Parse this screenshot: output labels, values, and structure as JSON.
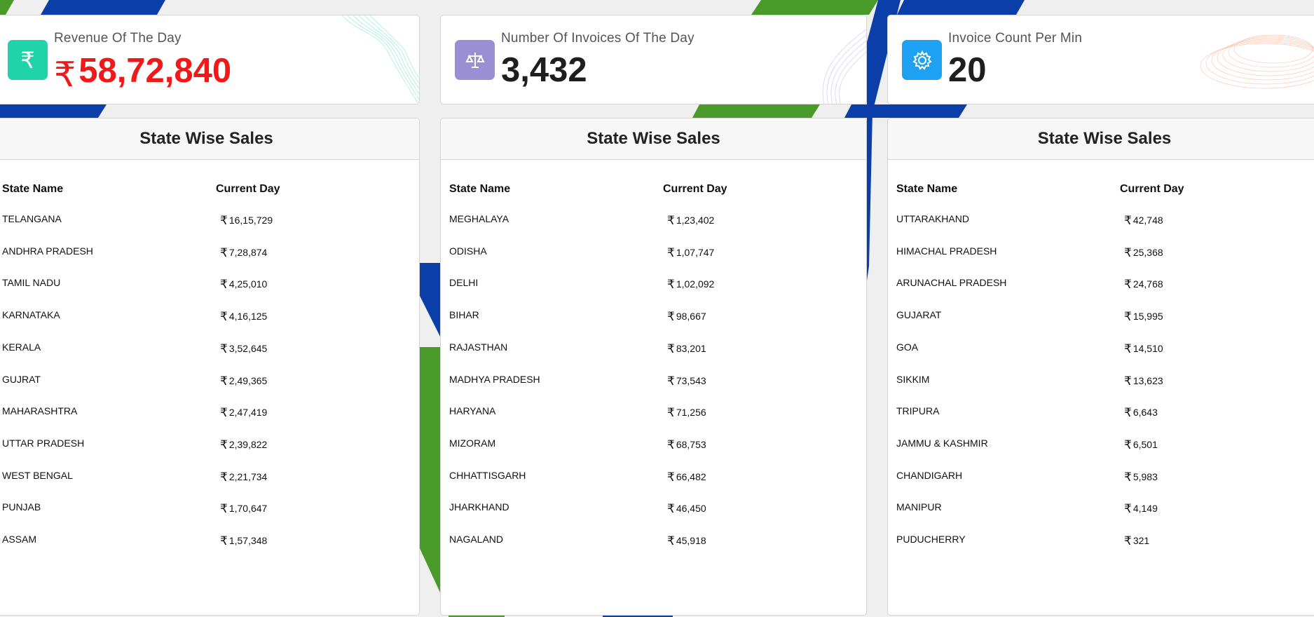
{
  "stats": [
    {
      "title": "Revenue Of The Day",
      "currency": "₹",
      "value": "58,72,840",
      "icon": "rupee-icon"
    },
    {
      "title": "Number Of Invoices Of The Day",
      "value": "3,432",
      "icon": "balance-scale-icon"
    },
    {
      "title": "Invoice Count Per Min",
      "value": "20",
      "icon": "gear-icon"
    }
  ],
  "colors": {
    "revenue_accent": "#f01818",
    "blue_stripe": "#0b3ea8",
    "green_stripe": "#4a9a2a",
    "icon_teal": "#1fd4a8",
    "icon_purple": "#9b8fd4",
    "icon_blue": "#1da1f2"
  },
  "tables": [
    {
      "title": "State Wise Sales",
      "col_state": "State Name",
      "col_day": "Current Day",
      "currency": "₹",
      "rows": [
        {
          "state": "TELANGANA",
          "amount": "16,15,729"
        },
        {
          "state": "ANDHRA PRADESH",
          "amount": "7,28,874"
        },
        {
          "state": "TAMIL NADU",
          "amount": "4,25,010"
        },
        {
          "state": "KARNATAKA",
          "amount": "4,16,125"
        },
        {
          "state": "KERALA",
          "amount": "3,52,645"
        },
        {
          "state": "GUJRAT",
          "amount": "2,49,365"
        },
        {
          "state": "MAHARASHTRA",
          "amount": "2,47,419"
        },
        {
          "state": "UTTAR PRADESH",
          "amount": "2,39,822"
        },
        {
          "state": "WEST BENGAL",
          "amount": "2,21,734"
        },
        {
          "state": "PUNJAB",
          "amount": "1,70,647"
        },
        {
          "state": "ASSAM",
          "amount": "1,57,348"
        }
      ]
    },
    {
      "title": "State Wise Sales",
      "col_state": "State Name",
      "col_day": "Current Day",
      "currency": "₹",
      "rows": [
        {
          "state": "MEGHALAYA",
          "amount": "1,23,402"
        },
        {
          "state": "ODISHA",
          "amount": "1,07,747"
        },
        {
          "state": "DELHI",
          "amount": "1,02,092"
        },
        {
          "state": "BIHAR",
          "amount": "98,667"
        },
        {
          "state": "RAJASTHAN",
          "amount": "83,201"
        },
        {
          "state": "MADHYA PRADESH",
          "amount": "73,543"
        },
        {
          "state": "HARYANA",
          "amount": "71,256"
        },
        {
          "state": "MIZORAM",
          "amount": "68,753"
        },
        {
          "state": "CHHATTISGARH",
          "amount": "66,482"
        },
        {
          "state": "JHARKHAND",
          "amount": "46,450"
        },
        {
          "state": "NAGALAND",
          "amount": "45,918"
        }
      ]
    },
    {
      "title": "State Wise Sales",
      "col_state": "State Name",
      "col_day": "Current Day",
      "currency": "₹",
      "rows": [
        {
          "state": "UTTARAKHAND",
          "amount": "42,748"
        },
        {
          "state": "HIMACHAL PRADESH",
          "amount": "25,368"
        },
        {
          "state": "ARUNACHAL PRADESH",
          "amount": "24,768"
        },
        {
          "state": "GUJARAT",
          "amount": "15,995"
        },
        {
          "state": "GOA",
          "amount": "14,510"
        },
        {
          "state": "SIKKIM",
          "amount": "13,623"
        },
        {
          "state": "TRIPURA",
          "amount": "6,643"
        },
        {
          "state": "JAMMU & KASHMIR",
          "amount": "6,501"
        },
        {
          "state": "CHANDIGARH",
          "amount": "5,983"
        },
        {
          "state": "MANIPUR",
          "amount": "4,149"
        },
        {
          "state": "PUDUCHERRY",
          "amount": "321"
        }
      ]
    }
  ]
}
